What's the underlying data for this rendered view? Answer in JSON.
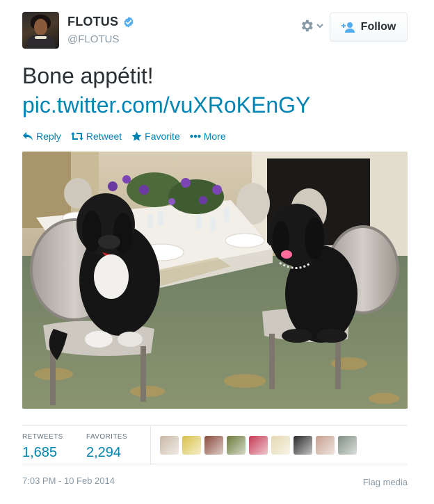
{
  "author": {
    "name": "FLOTUS",
    "handle": "@FLOTUS",
    "verified": true,
    "avatar_icon": "profile-photo"
  },
  "header": {
    "settings_icon": "gear-icon",
    "follow_label": "Follow",
    "follow_icon": "add-user-icon"
  },
  "tweet": {
    "text": "Bone appétit!",
    "link": "pic.twitter.com/vuXRoKEnGY"
  },
  "actions": [
    {
      "label": "Reply",
      "icon": "reply-icon"
    },
    {
      "label": "Retweet",
      "icon": "retweet-icon"
    },
    {
      "label": "Favorite",
      "icon": "star-icon"
    },
    {
      "label": "More",
      "icon": "more-dots-icon"
    }
  ],
  "media": {
    "description_icon": "photo"
  },
  "stats": {
    "retweets_label": "RETWEETS",
    "retweets_value": "1,685",
    "favorites_label": "FAVORITES",
    "favorites_value": "2,294"
  },
  "favoriters_colors": [
    "#c9b8a6",
    "#d9c24a",
    "#8a4b3c",
    "#6c7a3a",
    "#c73a55",
    "#e5d8b0",
    "#2a2a2a",
    "#c7a08f",
    "#7f8f84"
  ],
  "footer": {
    "timestamp": "7:03 PM - 10 Feb 2014",
    "flag_label": "Flag media"
  },
  "colors": {
    "link": "#0084b4",
    "muted": "#8899a6",
    "text": "#292f33",
    "verified": "#55acee"
  }
}
